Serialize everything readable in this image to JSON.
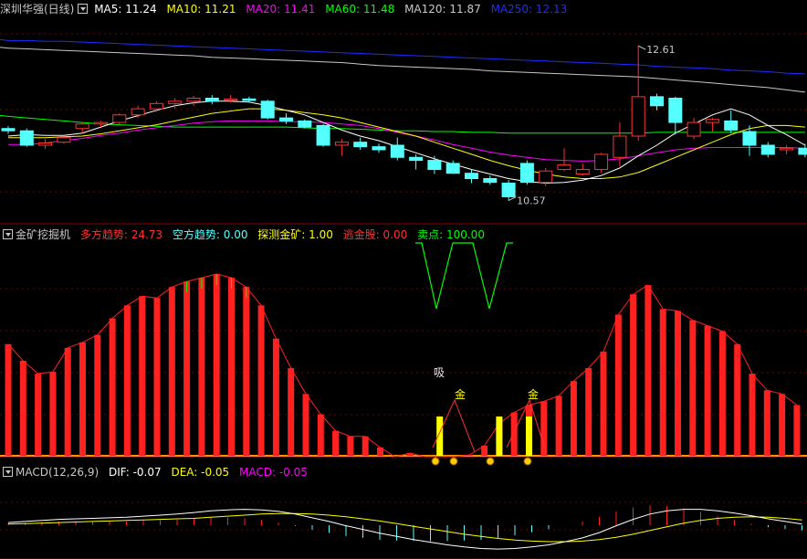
{
  "colors": {
    "up": "#ff3232",
    "down": "#54ffff",
    "ma5": "#ffffff",
    "ma10": "#ffff00",
    "ma20": "#ff00ff",
    "ma60": "#00ff00",
    "ma120": "#c8c8c8",
    "ma250": "#1c2fff",
    "bull": "#ff2020",
    "bear": "#54ffff",
    "probe": "#ffff00",
    "escape": "#ff3232",
    "sell": "#00ff00",
    "dif": "#ffffff",
    "dea": "#ffff00",
    "macd": "#ff00ff",
    "label": "#c8c8c8"
  },
  "price_header": {
    "stock_name": "深圳华强(日线)",
    "ma": [
      {
        "label": "MA5: 11.24",
        "color": "#ffffff"
      },
      {
        "label": "MA10: 11.21",
        "color": "#ffff00"
      },
      {
        "label": "MA20: 11.41",
        "color": "#ff00ff"
      },
      {
        "label": "MA60: 11.48",
        "color": "#00ff00"
      },
      {
        "label": "MA120: 11.87",
        "color": "#c8c8c8"
      },
      {
        "label": "MA250: 12.13",
        "color": "#1c2fff"
      }
    ]
  },
  "gold_header": {
    "indicator_name": "金矿挖掘机",
    "items": [
      {
        "label": "多方趋势: 24.73",
        "color": "#ff3232"
      },
      {
        "label": "空方趋势: 0.00",
        "color": "#54ffff"
      },
      {
        "label": "探测金矿: 1.00",
        "color": "#ffff00"
      },
      {
        "label": "逃金股: 0.00",
        "color": "#ff3232"
      },
      {
        "label": "卖点: 100.00",
        "color": "#00ff00"
      }
    ]
  },
  "macd_header": {
    "indicator_name": "MACD(12,26,9)",
    "items": [
      {
        "label": "DIF: -0.07",
        "color": "#ffffff"
      },
      {
        "label": "DEA: -0.05",
        "color": "#ffff00"
      },
      {
        "label": "MACD: -0.05",
        "color": "#ff00ff"
      }
    ]
  },
  "chart_data": [
    {
      "type": "candlestick",
      "title": "深圳华强(日线)",
      "ylim": [
        10.3,
        12.95
      ],
      "annotations": [
        {
          "text": "12.61",
          "bar": 34
        },
        {
          "text": "10.57",
          "bar": 27
        }
      ],
      "candles": [
        [
          11.52,
          11.55,
          11.45,
          11.49
        ],
        [
          11.49,
          11.52,
          11.28,
          11.3
        ],
        [
          11.3,
          11.38,
          11.25,
          11.33
        ],
        [
          11.34,
          11.42,
          11.32,
          11.4
        ],
        [
          11.52,
          11.6,
          11.46,
          11.58
        ],
        [
          11.58,
          11.62,
          11.54,
          11.6
        ],
        [
          11.6,
          11.72,
          11.58,
          11.7
        ],
        [
          11.7,
          11.82,
          11.66,
          11.78
        ],
        [
          11.78,
          11.88,
          11.74,
          11.85
        ],
        [
          11.85,
          11.92,
          11.78,
          11.88
        ],
        [
          11.88,
          11.95,
          11.82,
          11.92
        ],
        [
          11.92,
          11.96,
          11.84,
          11.88
        ],
        [
          11.9,
          11.96,
          11.86,
          11.91
        ],
        [
          11.91,
          11.94,
          11.86,
          11.89
        ],
        [
          11.88,
          11.9,
          11.64,
          11.66
        ],
        [
          11.66,
          11.72,
          11.58,
          11.62
        ],
        [
          11.62,
          11.64,
          11.52,
          11.54
        ],
        [
          11.56,
          11.58,
          11.28,
          11.3
        ],
        [
          11.3,
          11.38,
          11.16,
          11.34
        ],
        [
          11.34,
          11.4,
          11.24,
          11.28
        ],
        [
          11.28,
          11.32,
          11.2,
          11.24
        ],
        [
          11.3,
          11.4,
          11.1,
          11.14
        ],
        [
          11.14,
          11.18,
          10.98,
          11.1
        ],
        [
          11.1,
          11.16,
          10.92,
          10.98
        ],
        [
          11.06,
          11.1,
          10.92,
          10.93
        ],
        [
          10.93,
          10.98,
          10.8,
          10.86
        ],
        [
          10.86,
          10.9,
          10.78,
          10.81
        ],
        [
          10.8,
          10.84,
          10.57,
          10.62
        ],
        [
          11.06,
          11.1,
          10.78,
          10.81
        ],
        [
          10.81,
          11.0,
          10.76,
          10.96
        ],
        [
          10.98,
          11.26,
          10.96,
          11.04
        ],
        [
          10.92,
          11.06,
          10.9,
          10.98
        ],
        [
          10.98,
          11.2,
          10.94,
          11.18
        ],
        [
          11.14,
          11.6,
          11.02,
          11.42
        ],
        [
          11.42,
          12.61,
          11.36,
          11.94
        ],
        [
          11.94,
          11.98,
          11.76,
          11.82
        ],
        [
          11.92,
          11.94,
          11.44,
          11.6
        ],
        [
          11.42,
          11.66,
          11.38,
          11.6
        ],
        [
          11.6,
          11.66,
          11.48,
          11.64
        ],
        [
          11.62,
          11.76,
          11.46,
          11.5
        ],
        [
          11.48,
          11.56,
          11.16,
          11.3
        ],
        [
          11.3,
          11.34,
          11.14,
          11.18
        ],
        [
          11.24,
          11.3,
          11.18,
          11.26
        ],
        [
          11.26,
          11.32,
          11.14,
          11.18
        ]
      ],
      "ma": {
        "ma5": [
          11.42,
          11.44,
          11.43,
          11.43,
          11.46,
          11.54,
          11.62,
          11.69,
          11.76,
          11.82,
          11.86,
          11.88,
          11.88,
          11.87,
          11.82,
          11.76,
          11.7,
          11.6,
          11.5,
          11.42,
          11.36,
          11.28,
          11.2,
          11.12,
          11.05,
          10.98,
          10.92,
          10.86,
          10.82,
          10.8,
          10.81,
          10.84,
          10.9,
          11.0,
          11.16,
          11.3,
          11.46,
          11.58,
          11.7,
          11.78,
          11.7,
          11.56,
          11.44,
          11.3
        ],
        "ma10": [
          11.4,
          11.4,
          11.4,
          11.41,
          11.42,
          11.45,
          11.49,
          11.53,
          11.57,
          11.62,
          11.67,
          11.72,
          11.75,
          11.78,
          11.78,
          11.76,
          11.73,
          11.7,
          11.66,
          11.6,
          11.54,
          11.48,
          11.42,
          11.34,
          11.26,
          11.18,
          11.1,
          11.03,
          10.97,
          10.92,
          10.88,
          10.86,
          10.86,
          10.88,
          10.94,
          11.04,
          11.14,
          11.24,
          11.34,
          11.44,
          11.52,
          11.56,
          11.56,
          11.54
        ],
        "ma20": [
          11.31,
          11.31,
          11.33,
          11.36,
          11.39,
          11.43,
          11.46,
          11.5,
          11.53,
          11.56,
          11.59,
          11.61,
          11.62,
          11.62,
          11.62,
          11.61,
          11.61,
          11.6,
          11.58,
          11.56,
          11.52,
          11.47,
          11.42,
          11.37,
          11.31,
          11.26,
          11.21,
          11.17,
          11.14,
          11.11,
          11.1,
          11.09,
          11.1,
          11.12,
          11.16,
          11.2,
          11.24,
          11.26,
          11.27,
          11.27,
          11.27,
          11.27,
          11.27,
          11.26
        ],
        "ma60": [
          11.68,
          11.66,
          11.64,
          11.62,
          11.6,
          11.58,
          11.57,
          11.56,
          11.55,
          11.54,
          11.54,
          11.54,
          11.54,
          11.54,
          11.54,
          11.54,
          11.53,
          11.52,
          11.52,
          11.51,
          11.5,
          11.49,
          11.49,
          11.48,
          11.48,
          11.47,
          11.47,
          11.46,
          11.46,
          11.46,
          11.46,
          11.46,
          11.46,
          11.46,
          11.46,
          11.47,
          11.47,
          11.47,
          11.47,
          11.47,
          11.47,
          11.47,
          11.47,
          11.47
        ],
        "ma120": [
          12.58,
          12.57,
          12.56,
          12.55,
          12.54,
          12.53,
          12.52,
          12.51,
          12.5,
          12.49,
          12.48,
          12.46,
          12.45,
          12.44,
          12.43,
          12.42,
          12.41,
          12.4,
          12.39,
          12.37,
          12.35,
          12.34,
          12.33,
          12.32,
          12.31,
          12.3,
          12.28,
          12.27,
          12.26,
          12.25,
          12.24,
          12.23,
          12.22,
          12.21,
          12.2,
          12.18,
          12.16,
          12.14,
          12.12,
          12.1,
          12.08,
          12.06,
          12.03,
          12.0
        ],
        "ma250": [
          12.68,
          12.68,
          12.67,
          12.67,
          12.66,
          12.65,
          12.64,
          12.63,
          12.62,
          12.61,
          12.6,
          12.59,
          12.58,
          12.57,
          12.56,
          12.55,
          12.54,
          12.53,
          12.52,
          12.51,
          12.5,
          12.49,
          12.48,
          12.47,
          12.46,
          12.45,
          12.44,
          12.43,
          12.42,
          12.41,
          12.4,
          12.39,
          12.38,
          12.37,
          12.36,
          12.34,
          12.33,
          12.32,
          12.31,
          12.29,
          12.28,
          12.27,
          12.25,
          12.24
        ]
      }
    },
    {
      "type": "bar",
      "title": "金矿挖掘机",
      "ylim": [
        0,
        100
      ],
      "series": [
        {
          "name": "多方趋势",
          "values": [
            61,
            52,
            45,
            46,
            59,
            62,
            66,
            75,
            82,
            87,
            86,
            92,
            95,
            97,
            99,
            97,
            92,
            82,
            64,
            48,
            34,
            23,
            14,
            11,
            11,
            5,
            0,
            2,
            0,
            0,
            0,
            1,
            6,
            18,
            24,
            28,
            30,
            33,
            41,
            48,
            57,
            77,
            88,
            93,
            80,
            79,
            74,
            71,
            68,
            61,
            45,
            36,
            34,
            28
          ]
        },
        {
          "name": "卖点",
          "values": [
            100,
            100,
            100,
            100,
            100,
            100,
            100,
            100,
            100,
            100,
            100,
            100,
            100,
            100,
            100,
            100,
            100,
            100,
            100,
            100,
            100,
            100,
            100,
            100,
            100,
            100,
            100,
            100,
            100,
            100,
            100,
            100,
            100,
            100,
            100,
            100,
            100,
            100,
            100,
            100,
            100,
            100,
            100,
            100,
            100,
            100,
            100,
            100,
            100,
            100,
            100,
            100,
            100,
            100
          ]
        },
        {
          "name": "探测金矿",
          "markers": [
            29,
            33,
            35
          ]
        },
        {
          "name": "逃金股",
          "markers": [
            31,
            36
          ]
        }
      ],
      "annotations": [
        "吸",
        "金",
        "金"
      ]
    },
    {
      "type": "line",
      "title": "MACD(12,26,9)",
      "ylim": [
        -0.5,
        0.5
      ],
      "series": [
        {
          "name": "DIF",
          "values": [
            0.05,
            0.07,
            0.09,
            0.11,
            0.12,
            0.13,
            0.14,
            0.15,
            0.17,
            0.19,
            0.21,
            0.24,
            0.27,
            0.29,
            0.3,
            0.29,
            0.26,
            0.21,
            0.14,
            0.07,
            -0.01,
            -0.08,
            -0.15,
            -0.21,
            -0.27,
            -0.32,
            -0.37,
            -0.41,
            -0.44,
            -0.45,
            -0.44,
            -0.41,
            -0.37,
            -0.31,
            -0.24,
            -0.14,
            -0.01,
            0.11,
            0.21,
            0.27,
            0.3,
            0.3,
            0.27,
            0.23,
            0.18,
            0.12,
            0.07,
            0.02
          ]
        },
        {
          "name": "DEA",
          "values": [
            0.02,
            0.03,
            0.04,
            0.05,
            0.06,
            0.07,
            0.08,
            0.09,
            0.1,
            0.11,
            0.12,
            0.13,
            0.15,
            0.17,
            0.19,
            0.21,
            0.22,
            0.22,
            0.21,
            0.19,
            0.16,
            0.12,
            0.08,
            0.03,
            -0.02,
            -0.07,
            -0.12,
            -0.17,
            -0.21,
            -0.25,
            -0.28,
            -0.3,
            -0.31,
            -0.31,
            -0.3,
            -0.27,
            -0.23,
            -0.17,
            -0.1,
            -0.03,
            0.04,
            0.09,
            0.13,
            0.15,
            0.16,
            0.15,
            0.13,
            0.1
          ]
        },
        {
          "name": "MACD",
          "values": [
            0.06,
            0.08,
            0.1,
            0.12,
            0.12,
            0.12,
            0.12,
            0.12,
            0.14,
            0.16,
            0.18,
            0.22,
            0.24,
            0.24,
            0.22,
            0.16,
            0.08,
            -0.02,
            -0.14,
            -0.24,
            -0.34,
            -0.4,
            -0.46,
            -0.48,
            -0.5,
            -0.5,
            -0.5,
            -0.48,
            -0.46,
            -0.4,
            -0.32,
            -0.22,
            -0.12,
            0.0,
            0.12,
            0.26,
            0.44,
            0.56,
            0.62,
            0.6,
            0.52,
            0.42,
            0.28,
            0.16,
            0.04,
            -0.06,
            -0.12,
            -0.16
          ]
        }
      ]
    }
  ]
}
